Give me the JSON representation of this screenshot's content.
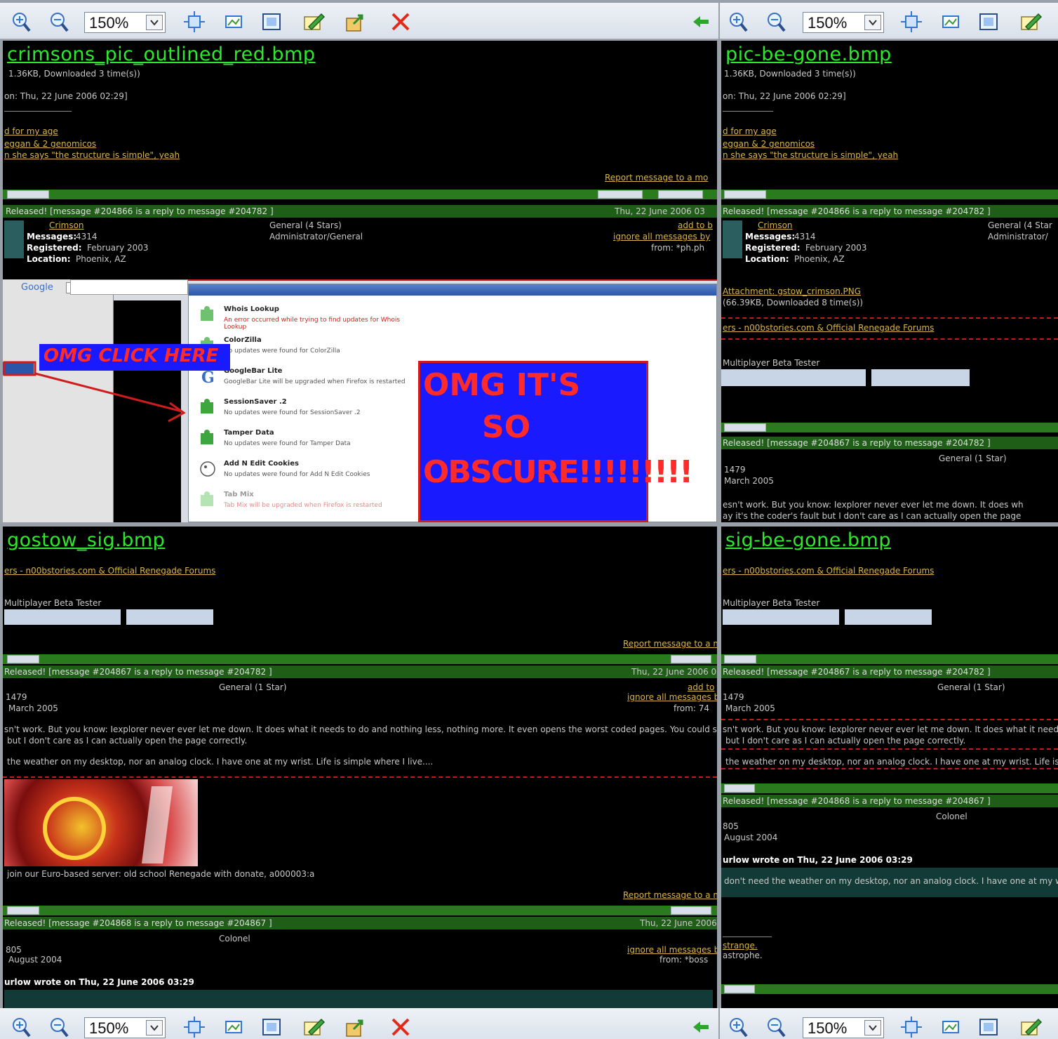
{
  "toolbar": {
    "zoom_value": "150%",
    "icons": [
      "zoom-in-icon",
      "zoom-out-icon",
      "fit-icon",
      "actual-size-icon",
      "fullscreen-icon",
      "edit-icon",
      "export-icon",
      "close-icon",
      "back-arrow-icon"
    ]
  },
  "panes": {
    "top_left": {
      "filename": "crimsons_pic_outlined_red.bmp",
      "lines": {
        "size": "1.36KB, Downloaded 3 time(s))",
        "date": "on: Thu, 22 June 2006 02:29]",
        "link1": "d for my age",
        "link2": "eggan & 2 genomicos",
        "link3": "n she says \"the structure is simple\", yeah",
        "report": "Report message to a mo",
        "msg_header": "Released! [message #204866 is a reply to message #204782 ]",
        "msg_date": "Thu, 22 June 2006 03",
        "user": "Crimson",
        "messages_label": "Messages:",
        "messages_value": "4314",
        "registered_label": "Registered:",
        "registered_value": "February 2003",
        "location_label": "Location:",
        "location_value": "Phoenix, AZ",
        "rank1": "General (4 Stars)",
        "rank2": "Administrator/General",
        "add_to": "add to b",
        "ignore": "ignore all messages by",
        "from": "from: *ph.ph"
      },
      "overlay": {
        "click_here": "OMG CLICK HERE",
        "obscure_line1": "OMG IT'S",
        "obscure_line2": "SO",
        "obscure_line3": "OBSCURE!!!!!!!!!"
      },
      "extensions": [
        {
          "name": "Whois Lookup",
          "desc": "An error occurred while trying to find updates for Whois Lookup"
        },
        {
          "name": "ColorZilla",
          "desc": "No updates were found for ColorZilla"
        },
        {
          "name": "GoogleBar Lite",
          "desc": "GoogleBar Lite will be upgraded when Firefox is restarted"
        },
        {
          "name": "SessionSaver .2",
          "desc": "No updates were found for SessionSaver .2"
        },
        {
          "name": "Tamper Data",
          "desc": "No updates were found for Tamper Data"
        },
        {
          "name": "Add N Edit Cookies",
          "desc": "No updates were found for Add N Edit Cookies"
        },
        {
          "name": "Tab Mix",
          "desc": "Tab Mix will be upgraded when Firefox is restarted"
        }
      ],
      "search_label": "Google"
    },
    "top_right": {
      "filename": "pic-be-gone.bmp",
      "lines": {
        "size": "1.36KB, Downloaded 3 time(s))",
        "date": "on: Thu, 22 June 2006 02:29]",
        "link1": "d for my age",
        "link2": "eggan & 2 genomicos",
        "link3": "n she says \"the structure is simple\", yeah",
        "msg_header": "Released! [message #204866 is a reply to message #204782 ]",
        "user": "Crimson",
        "messages_label": "Messages:",
        "messages_value": "4314",
        "registered_label": "Registered:",
        "registered_value": "February 2003",
        "location_label": "Location:",
        "location_value": "Phoenix, AZ",
        "rank1": "General (4 Star",
        "rank2": "Administrator/",
        "attachment": "Attachment: gstow_crimson.PNG",
        "attachment_size": "(66.39KB, Downloaded 8 time(s))",
        "sig": "ers - n00bstories.com & Official Renegade Forums",
        "beta": "Multiplayer Beta Tester",
        "msg_header2": "Released! [message #204867 is a reply to message #204782 ]",
        "rank3": "General (1 Star)",
        "num": "1479",
        "reg2": "March 2005",
        "body1": "esn't work. But you know: Iexplorer never ever let me down. It does wh",
        "body2": "ay it's the coder's fault but I don't care as I can actually open the page"
      }
    },
    "bottom_left": {
      "filename": "gostow_sig.bmp",
      "lines": {
        "sig": "ers - n00bstories.com & Official Renegade Forums",
        "beta": "Multiplayer Beta Tester",
        "report": "Report message to a m",
        "msg_header": "Released! [message #204867 is a reply to message #204782 ]",
        "msg_date": "Thu, 22 June 2006 0",
        "rank": "General (1 Star)",
        "num": "1479",
        "reg": "March 2005",
        "add_to": "add to",
        "ignore": "ignore all messages b",
        "from": "from: 74",
        "body1": "sn't work. But you know: Iexplorer never ever let me down. It does what it needs to do and nothing less, nothing more. It even opens the worst coded pages. You could say",
        "body2": "but I don't care as I can actually open the page correctly.",
        "body3": "the weather on my desktop, nor an analog clock. I have one at my wrist. Life is simple where I live....",
        "server": "join our Euro-based server: old school Renegade with donate, a000003:a",
        "report2": "Report message to a m",
        "msg_header2": "Released! [message #204868 is a reply to message #204867 ]",
        "msg_date2": "Thu, 22 June 2006",
        "rank2": "Colonel",
        "num2": "805",
        "reg2": "August 2004",
        "ignore2": "ignore all messages b",
        "from2": "from: *boss",
        "wrote": "urlow wrote on Thu, 22 June 2006 03:29"
      }
    },
    "bottom_right": {
      "filename": "sig-be-gone.bmp",
      "lines": {
        "sig": "ers - n00bstories.com & Official Renegade Forums",
        "beta": "Multiplayer Beta Tester",
        "msg_header": "Released! [message #204867 is a reply to message #204782 ]",
        "rank": "General (1 Star)",
        "num": "1479",
        "reg": "March 2005",
        "body1": "sn't work. But you know: Iexplorer never ever let me down. It does what it needs",
        "body2": "but I don't care as I can actually open the page correctly.",
        "body3": "the weather on my desktop, nor an analog clock. I have one at my wrist. Life is s",
        "msg_header2": "Released! [message #204868 is a reply to message #204867 ]",
        "rank2": "Colonel",
        "num2": "805",
        "reg2": "August 2004",
        "wrote": "urlow wrote on Thu, 22 June 2006 03:29",
        "quote": "don't need the weather on my desktop, nor an analog clock. I have one at my wrist",
        "sig2": "strange.",
        "sig3": "astrophe."
      }
    }
  },
  "colors": {
    "filename_green": "#2ee82e",
    "link_gold": "#d9b54a",
    "bar_green": "#2a7a1e",
    "alert_red": "#d01c1c",
    "overlay_blue": "#1a1aff"
  }
}
